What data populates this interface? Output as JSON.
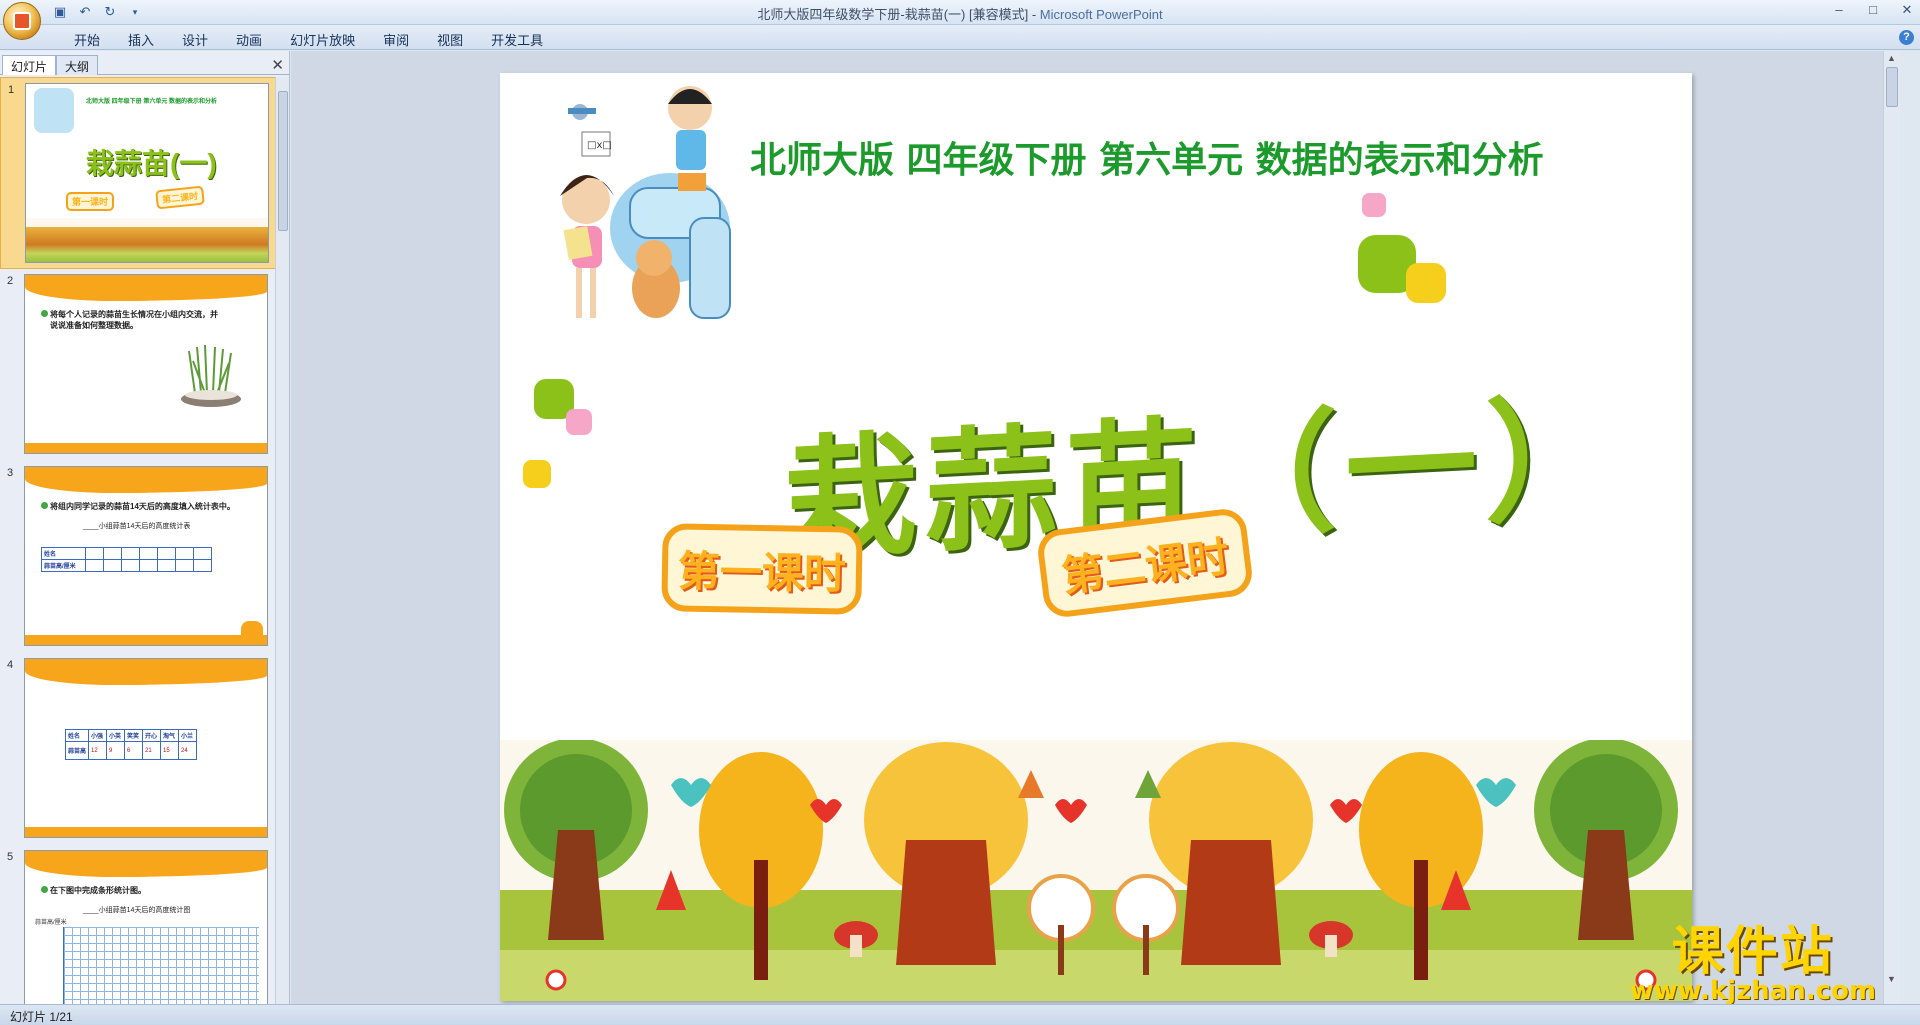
{
  "window": {
    "title": "北师大版四年级数学下册-栽蒜苗(一) [兼容模式]",
    "separator": " - ",
    "app_name": "Microsoft PowerPoint",
    "controls": [
      "–",
      "□",
      "✕"
    ]
  },
  "qat": {
    "icons": [
      "save-icon",
      "undo-icon",
      "redo-icon",
      "customize-icon"
    ]
  },
  "ribbon": {
    "tabs": [
      "开始",
      "插入",
      "设计",
      "动画",
      "幻灯片放映",
      "审阅",
      "视图",
      "开发工具"
    ],
    "help": "?"
  },
  "left_pane": {
    "tabs": [
      "幻灯片",
      "大纲"
    ],
    "close": "✕",
    "thumbnails": [
      {
        "num": "1",
        "header": "北师大版 四年级下册 第六单元 数据的表示和分析",
        "title": "栽蒜苗(一)",
        "btn1": "第一课时",
        "btn2": "第二课时"
      },
      {
        "num": "2",
        "text1": "将每个人记录的蒜苗生长情况在小组内交流，并",
        "text2": "说说准备如何整理数据。"
      },
      {
        "num": "3",
        "text1": "将组内同学记录的蒜苗14天后的高度填入统计表中。",
        "subtitle": "小组蒜苗14天后的高度统计表",
        "row1": "姓名",
        "row2": "蒜苗高/厘米"
      },
      {
        "num": "4",
        "headers": [
          "姓名",
          "小强",
          "小英",
          "笑笑",
          "开心",
          "淘气",
          "小兰"
        ],
        "row_label": "蒜苗高",
        "values": [
          "12",
          "9",
          "6",
          "21",
          "15",
          "24"
        ]
      },
      {
        "num": "5",
        "text1": "在下图中完成条形统计图。",
        "subtitle": "小组蒜苗14天后的高度统计图",
        "ylabel": "蒜苗高/厘米"
      }
    ]
  },
  "slide": {
    "header": "北师大版  四年级下册  第六单元  数据的表示和分析",
    "title": "栽蒜苗（一）",
    "lesson1": "第一课时",
    "lesson2": "第二课时",
    "colors": {
      "green_header": "#1c9a2b",
      "title_green": "#8cc11a",
      "orange": "#f5a21b"
    }
  },
  "watermark": {
    "cn": "课件站",
    "url": "www.kjzhan.com"
  },
  "status": {
    "slide_info": "幻灯片 1/21"
  }
}
